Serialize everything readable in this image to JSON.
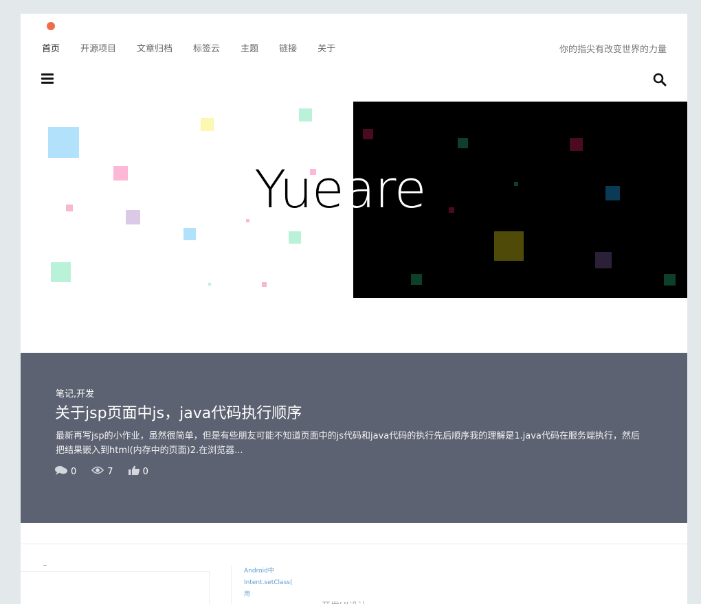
{
  "nav": {
    "items": [
      "首页",
      "开源项目",
      "文章归档",
      "标签云",
      "主题",
      "链接",
      "关于"
    ],
    "active_index": 0
  },
  "slogan": "你的指尖有改变世界的力量",
  "icons": {
    "menu": "menu-icon",
    "search": "search-icon",
    "comment": "comment-icon",
    "views": "eye-icon",
    "likes": "thumbs-up-icon"
  },
  "logo": {
    "text_dark": "Yue",
    "text_light": "are"
  },
  "colors": {
    "accent_dot": "#ef6d4a",
    "post_bg": "#5d6272",
    "page_bg": "#e3e9eb"
  },
  "post": {
    "categories": "笔记,开发",
    "title": "关于jsp页面中js，java代码执行顺序",
    "excerpt": "最新再写jsp的小作业，虽然很简单，但是有些朋友可能不知道页面中的js代码和java代码的执行先后顺序我的理解是1.java代码在服务端执行，然后把结果嵌入到html(内存中的页面)2.在浏览器...",
    "comments": "0",
    "views": "7",
    "likes": "0"
  },
  "footer_preview": {
    "side_links": [
      "Android中",
      "Intent.setClass(",
      "用"
    ],
    "subtext": "开发UI设计"
  }
}
